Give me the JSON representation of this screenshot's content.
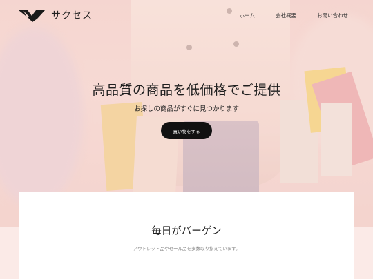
{
  "brand": {
    "name": "サクセス",
    "logo_icon": "bird-logo-icon"
  },
  "nav": {
    "items": [
      "ホーム",
      "会社概要",
      "お問い合わせ"
    ]
  },
  "hero": {
    "title": "高品質の商品を低価格でご提供",
    "subtitle": "お探しの商品がすぐに見つかります",
    "cta_label": "買い物をする"
  },
  "section": {
    "title": "毎日がバーゲン",
    "description": "アウトレット品やセール品を多数取り揃えています。"
  },
  "colors": {
    "accent": "#111111",
    "hero_tint": "#f6d9d3",
    "card_bg": "#ffffff"
  }
}
